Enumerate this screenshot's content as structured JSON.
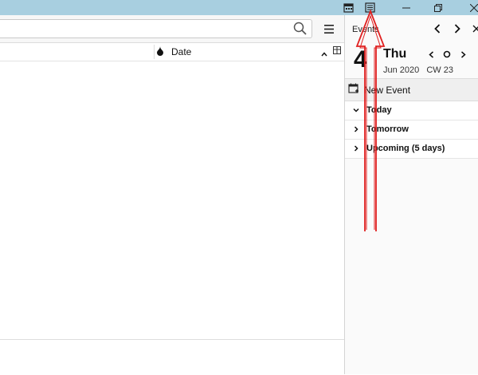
{
  "titlebar": {
    "icons": [
      "calendar-icon",
      "tasks-icon",
      "minimize-icon",
      "restore-icon",
      "close-icon"
    ],
    "background": "#a8cfe0"
  },
  "search": {
    "value": "",
    "placeholder": ""
  },
  "columns": {
    "date": "Date"
  },
  "today_pane": {
    "title": "Events",
    "day_number": "4",
    "day_name": "Thu",
    "month_year": "Jun 2020",
    "calendar_week": "CW 23",
    "new_event_label": "New Event",
    "agenda": [
      {
        "label": "Today",
        "expanded": true
      },
      {
        "label": "Tomorrow",
        "expanded": false
      },
      {
        "label": "Upcoming (5 days)",
        "expanded": false
      }
    ]
  },
  "colors": {
    "annotation": "#e02020"
  }
}
